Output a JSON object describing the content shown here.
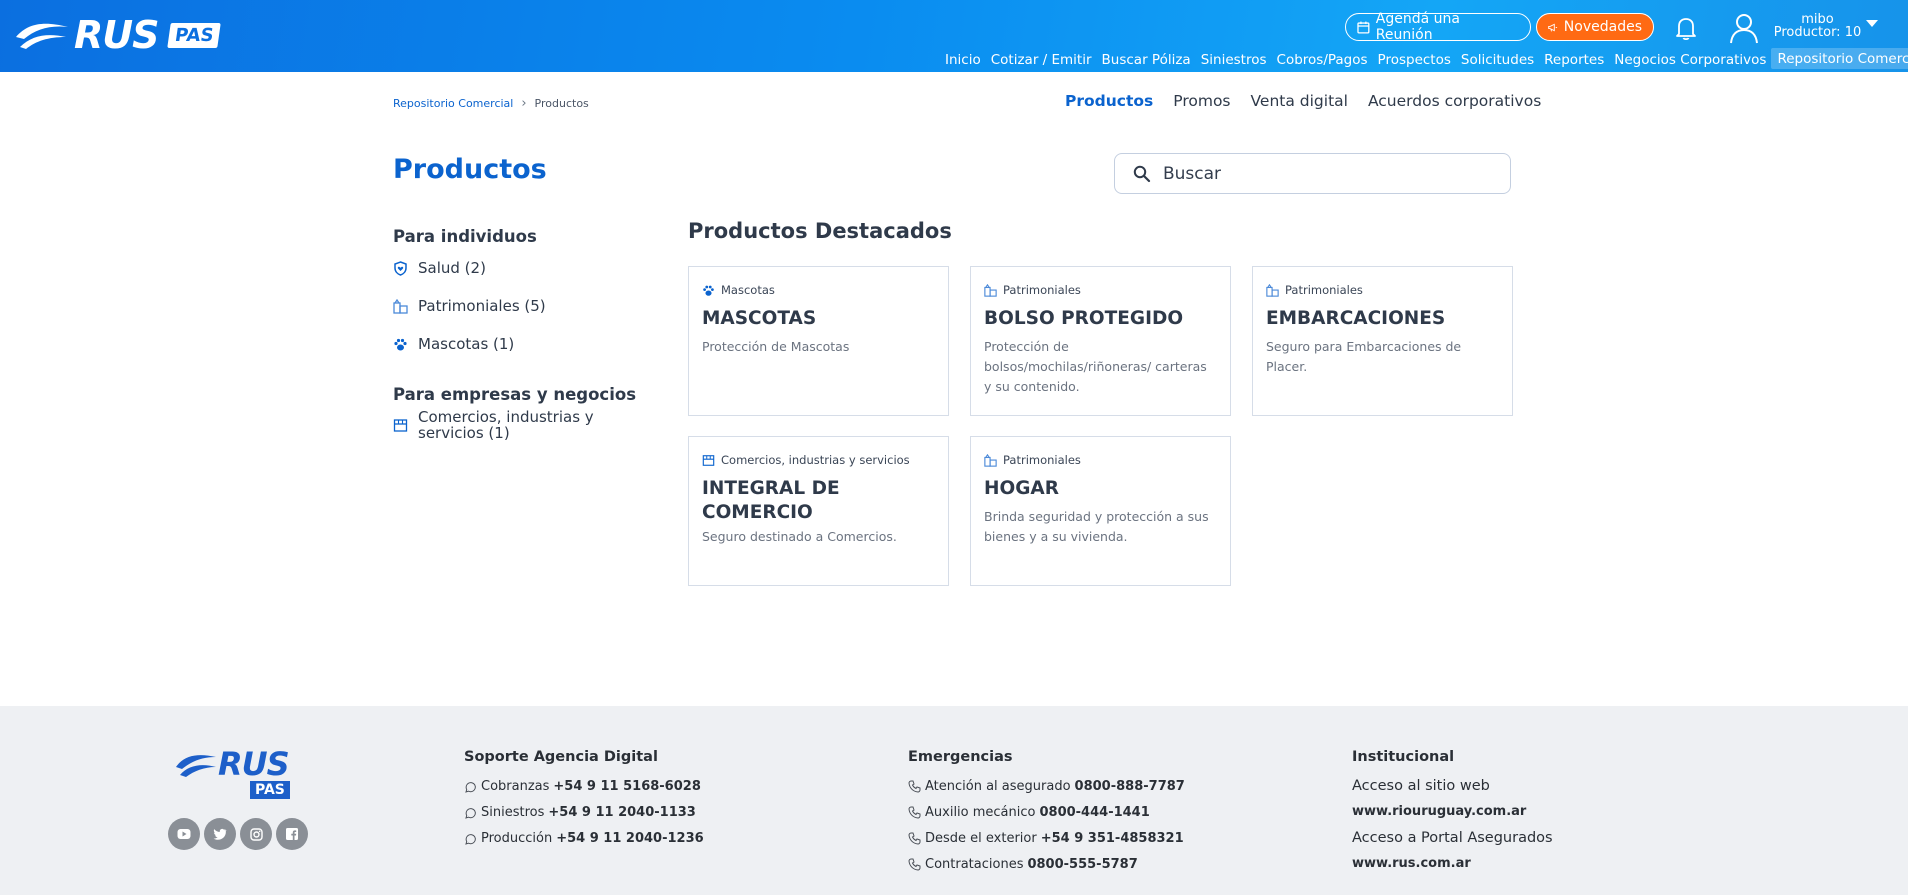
{
  "header": {
    "logo_text": "RUS",
    "logo_badge": "PAS",
    "agenda_label": "Agendá una Reunión",
    "novedades_label": "Novedades",
    "user_name": "mibo",
    "user_role": "Productor: 10",
    "nav": [
      "Inicio",
      "Cotizar / Emitir",
      "Buscar Póliza",
      "Siniestros",
      "Cobros/Pagos",
      "Prospectos",
      "Solicitudes",
      "Reportes",
      "Negocios Corporativos",
      "Repositorio Comercial"
    ],
    "active_nav": "Repositorio Comercial",
    "brand_color": "#0b6fe0",
    "accent_color": "#ff6a13"
  },
  "breadcrumb": {
    "parent": "Repositorio Comercial",
    "current": "Productos"
  },
  "subtabs": [
    "Productos",
    "Promos",
    "Venta digital",
    "Acuerdos corporativos"
  ],
  "page_title": "Productos",
  "search": {
    "placeholder": "Buscar"
  },
  "sidebar": {
    "individuals_title": "Para individuos",
    "individuals": [
      {
        "label": "Salud (2)",
        "icon": "shield-heart-icon"
      },
      {
        "label": "Patrimoniales (5)",
        "icon": "property-icon"
      },
      {
        "label": "Mascotas (1)",
        "icon": "paw-icon"
      }
    ],
    "business_title": "Para empresas y negocios",
    "business": [
      {
        "label": "Comercios, industrias y servicios (1)",
        "icon": "store-icon"
      }
    ]
  },
  "featured_title": "Productos Destacados",
  "products": [
    {
      "category": "Mascotas",
      "icon": "paw-icon",
      "name": "MASCOTAS",
      "description": "Protección de Mascotas"
    },
    {
      "category": "Patrimoniales",
      "icon": "property-icon",
      "name": "BOLSO PROTEGIDO",
      "description": "Protección de bolsos/mochilas/riñoneras/ carteras y su contenido."
    },
    {
      "category": "Patrimoniales",
      "icon": "property-icon",
      "name": "EMBARCACIONES",
      "description": "Seguro para Embarcaciones de Placer."
    },
    {
      "category": "Comercios, industrias y servicios",
      "icon": "store-icon",
      "name": "INTEGRAL DE COMERCIO",
      "description": "Seguro destinado a Comercios."
    },
    {
      "category": "Patrimoniales",
      "icon": "property-icon",
      "name": "HOGAR",
      "description": "Brinda seguridad y protección a sus bienes y a su vivienda."
    }
  ],
  "footer": {
    "logo_text": "RUS",
    "logo_badge": "PAS",
    "socials": [
      "youtube-icon",
      "twitter-icon",
      "instagram-icon",
      "facebook-icon"
    ],
    "support": {
      "title": "Soporte Agencia Digital",
      "rows": [
        {
          "label": "Cobranzas",
          "value": "+54 9 11 5168-6028"
        },
        {
          "label": "Siniestros",
          "value": "+54 9 11 2040-1133"
        },
        {
          "label": "Producción",
          "value": "+54 9 11 2040-1236"
        }
      ]
    },
    "emergencies": {
      "title": "Emergencias",
      "rows": [
        {
          "label": "Atención al asegurado",
          "value": "0800-888-7787"
        },
        {
          "label": "Auxilio mecánico",
          "value": "0800-444-1441"
        },
        {
          "label": "Desde el exterior",
          "value": "+54 9 351-4858321"
        },
        {
          "label": "Contrataciones",
          "value": "0800-555-5787"
        }
      ]
    },
    "institutional": {
      "title": "Institucional",
      "site_label": "Acceso al sitio web",
      "site_url": "www.riouruguay.com.ar",
      "portal_label": "Acceso a Portal Asegurados",
      "portal_url": "www.rus.com.ar"
    }
  }
}
